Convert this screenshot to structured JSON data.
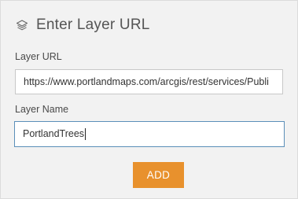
{
  "header": {
    "title": "Enter Layer URL",
    "icon": "layers-icon"
  },
  "fields": {
    "url": {
      "label": "Layer URL",
      "value": "https://www.portlandmaps.com/arcgis/rest/services/Publi"
    },
    "name": {
      "label": "Layer Name",
      "value": "PortlandTrees"
    }
  },
  "actions": {
    "add_label": "ADD"
  },
  "colors": {
    "panel_bg": "#f2f2f2",
    "button_bg": "#e8912d",
    "focus_border": "#5b8fb9",
    "title_text": "#555555"
  }
}
